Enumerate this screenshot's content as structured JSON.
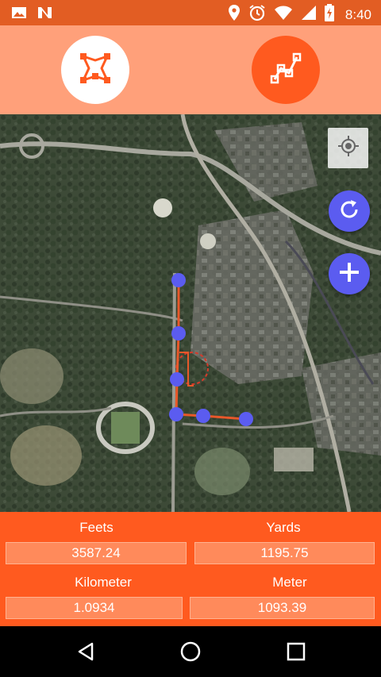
{
  "status_bar": {
    "time": "8:40",
    "icons": [
      "image-icon",
      "n-app-icon",
      "location-pin-icon",
      "alarm-icon",
      "wifi-icon",
      "cellular-signal-icon",
      "battery-charging-icon"
    ]
  },
  "toolbar": {
    "area_mode_icon": "polygon-area-icon",
    "distance_mode_icon": "polyline-distance-icon",
    "active_mode": "distance"
  },
  "map": {
    "controls": [
      "crosshair-icon",
      "refresh-icon",
      "plus-icon"
    ],
    "path_color": "#e8582a",
    "marker_color": "#5b5cf0"
  },
  "measurements": {
    "feet_label": "Feets",
    "feet_value": "3587.24",
    "yards_label": "Yards",
    "yards_value": "1195.75",
    "km_label": "Kilometer",
    "km_value": "1.0934",
    "meter_label": "Meter",
    "meter_value": "1093.39"
  },
  "navigation": [
    "back-icon",
    "home-icon",
    "recents-icon"
  ],
  "colors": {
    "status_bar": "#e25d23",
    "toolbar": "#ffa07a",
    "panel": "#ff5a1f",
    "accent": "#5b5cf0"
  }
}
